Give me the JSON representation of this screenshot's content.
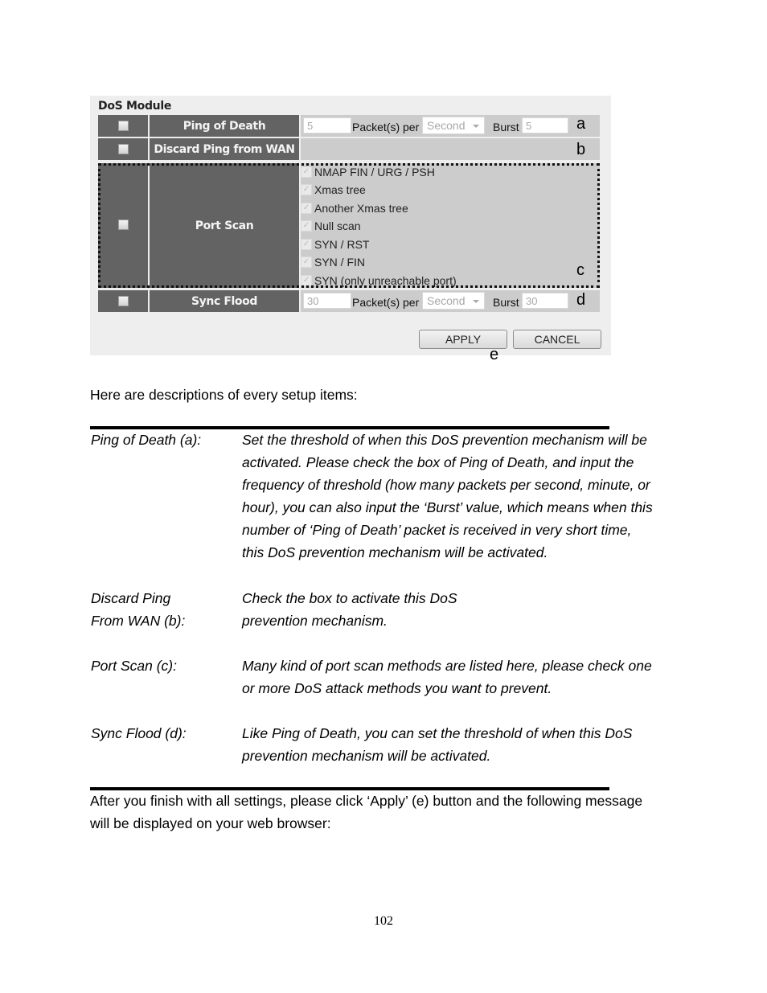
{
  "panel": {
    "title": "DoS Module",
    "rows": {
      "ping_of_death": {
        "name": "Ping of Death",
        "checked": false,
        "packets": "5",
        "per_label": "Packet(s) per",
        "unit": "Second",
        "burst_label": "Burst",
        "burst": "5",
        "marker": "a"
      },
      "discard_ping": {
        "name": "Discard Ping from WAN",
        "checked": false,
        "marker": "b"
      },
      "port_scan": {
        "name": "Port Scan",
        "checked": false,
        "marker": "c",
        "check_mark": "✓",
        "items": [
          "NMAP FIN / URG / PSH",
          "Xmas tree",
          "Another Xmas tree",
          "Null scan",
          "SYN / RST",
          "SYN / FIN",
          "SYN (only unreachable port)"
        ]
      },
      "sync_flood": {
        "name": "Sync Flood",
        "checked": false,
        "packets": "30",
        "per_label": "Packet(s) per",
        "unit": "Second",
        "burst_label": "Burst",
        "burst": "30",
        "marker": "d"
      }
    },
    "buttons": {
      "apply": "APPLY",
      "cancel": "CANCEL",
      "marker": "e"
    }
  },
  "document": {
    "intro": "Here are descriptions of every setup items:",
    "definitions": [
      {
        "term_lines": [
          "Ping of Death (a):"
        ],
        "desc_lines": [
          "Set the threshold of when this DoS prevention mechanism will be",
          "activated. Please check the box of Ping of Death, and input the",
          "frequency of threshold (how many packets per second, minute, or",
          "hour), you can also input the ‘Burst’ value, which means when this",
          "number of ‘Ping of Death’ packet is received in very short time,",
          "this DoS prevention mechanism will be activated."
        ]
      },
      {
        "term_lines": [
          "Discard Ping",
          "From WAN (b):"
        ],
        "desc_lines": [
          "Check the box to activate this DoS",
          "prevention mechanism."
        ]
      },
      {
        "term_lines": [
          "Port Scan (c):"
        ],
        "desc_lines": [
          "Many kind of port scan methods are listed here, please check one",
          "or more DoS attack methods you want to prevent."
        ]
      },
      {
        "term_lines": [
          "Sync Flood (d):"
        ],
        "desc_lines": [
          "Like Ping of Death, you can set the threshold of when this DoS",
          "prevention mechanism will be activated."
        ]
      }
    ],
    "outro_lines": [
      "After you finish with all settings, please click ‘Apply’ (e) button and the following message",
      "will be displayed on your web browser:"
    ],
    "page_number": "102"
  }
}
